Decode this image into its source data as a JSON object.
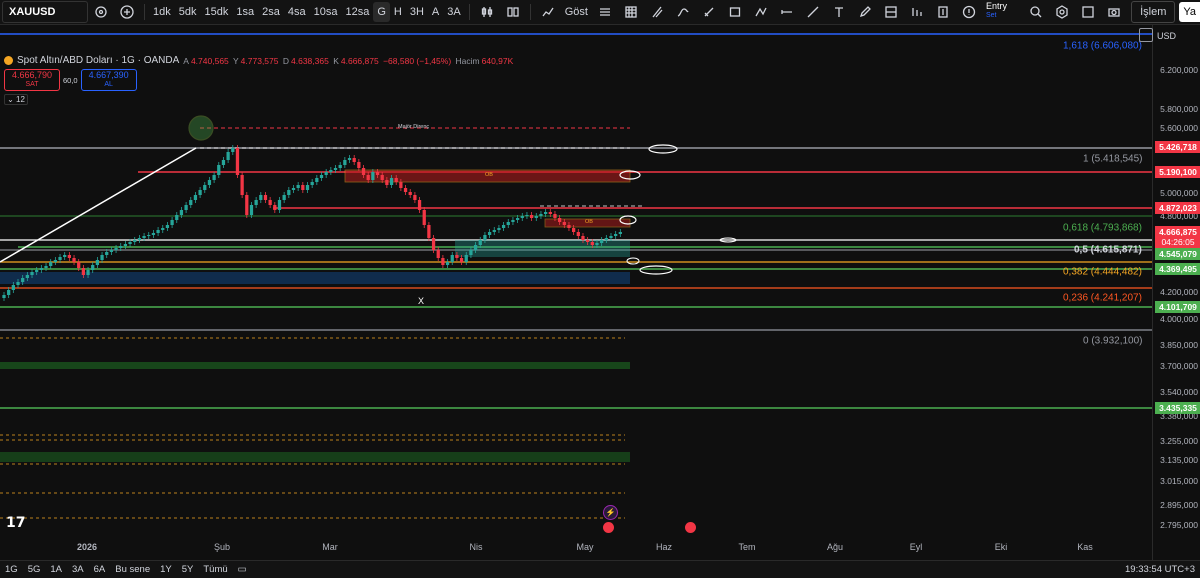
{
  "toolbar": {
    "symbol": "XAUUSD",
    "timeframes": [
      "1dk",
      "5dk",
      "15dk",
      "1sa",
      "2sa",
      "4sa",
      "10sa",
      "12sa",
      "G",
      "H",
      "3H",
      "A",
      "3A"
    ],
    "active_timeframe": "G",
    "indicators_label": "Göst",
    "entry_label": "Entry",
    "entry_sub": "Set",
    "trade_label": "İşlem",
    "cut_label": "Ya"
  },
  "legend": {
    "title": "Spot Altın/ABD Doları · 1G · OANDA",
    "open_label": "A",
    "open": "4.740,565",
    "high_label": "Y",
    "high": "4.773,575",
    "low_label": "D",
    "low": "4.638,365",
    "close_label": "K",
    "close": "4.666,875",
    "change": "−68,580 (−1,45%)",
    "volume_label": "Hacim",
    "volume": "640,97K",
    "sell_price": "4.666,790",
    "sell_label": "SAT",
    "spread": "60,0",
    "buy_price": "4.667,390",
    "buy_label": "AL",
    "collapse_count": "12"
  },
  "price_axis": {
    "currency": "USD",
    "labels": [
      "6.200,000",
      "5.800,000",
      "5.600,000",
      "5.000,000",
      "4.800,000",
      "4.200,000",
      "4.000,000",
      "3.850,000",
      "3.700,000",
      "3.540,000",
      "3.380,000",
      "3.255,000",
      "3.135,000",
      "3.015,000",
      "2.895,000",
      "2.795,000"
    ],
    "tags": [
      {
        "value": "5.426,718",
        "color": "#f23645"
      },
      {
        "value": "5.190,100",
        "color": "#f23645"
      },
      {
        "value": "4.872,023",
        "color": "#f23645"
      },
      {
        "value": "4.666,875",
        "color": "#f23645"
      },
      {
        "value": "04:26:05",
        "color": "#f23645"
      },
      {
        "value": "4.545,079",
        "color": "#4caf50"
      },
      {
        "value": "4.369,495",
        "color": "#4caf50"
      },
      {
        "value": "4.101,709",
        "color": "#4caf50"
      },
      {
        "value": "3.435,335",
        "color": "#4caf50"
      }
    ]
  },
  "fib_labels": [
    {
      "text": "1,618 (6.606,080)",
      "color": "#2962ff"
    },
    {
      "text": "1 (5.418,545)",
      "color": "#9598a1"
    },
    {
      "text": "0,618 (4.793,868)",
      "color": "#4caf50"
    },
    {
      "text": "0,5 (4.615,871)",
      "color": "#d1d4dc"
    },
    {
      "text": "0,382 (4.444,482)",
      "color": "#f5a623"
    },
    {
      "text": "0,236 (4.241,207)",
      "color": "#ff5722"
    },
    {
      "text": "0 (3.932,100)",
      "color": "#9598a1"
    }
  ],
  "annotations": {
    "major_resistance": "Majör Direnç",
    "ob1": "OB",
    "ob2": "OB",
    "x_mark": "X"
  },
  "time_axis": [
    "2026",
    "Şub",
    "Mar",
    "Nis",
    "May",
    "Haz",
    "Tem",
    "Ağu",
    "Eyl",
    "Eki",
    "Kas"
  ],
  "bottom_bar": {
    "ranges": [
      "1G",
      "5G",
      "1A",
      "3A",
      "6A",
      "Bu sene",
      "1Y",
      "5Y",
      "Tümü"
    ],
    "clock": "19:33:54 UTC+3"
  },
  "colors": {
    "background": "#0f0f0f",
    "up": "#26a69a",
    "down": "#f23645",
    "accent_blue": "#2962ff"
  }
}
